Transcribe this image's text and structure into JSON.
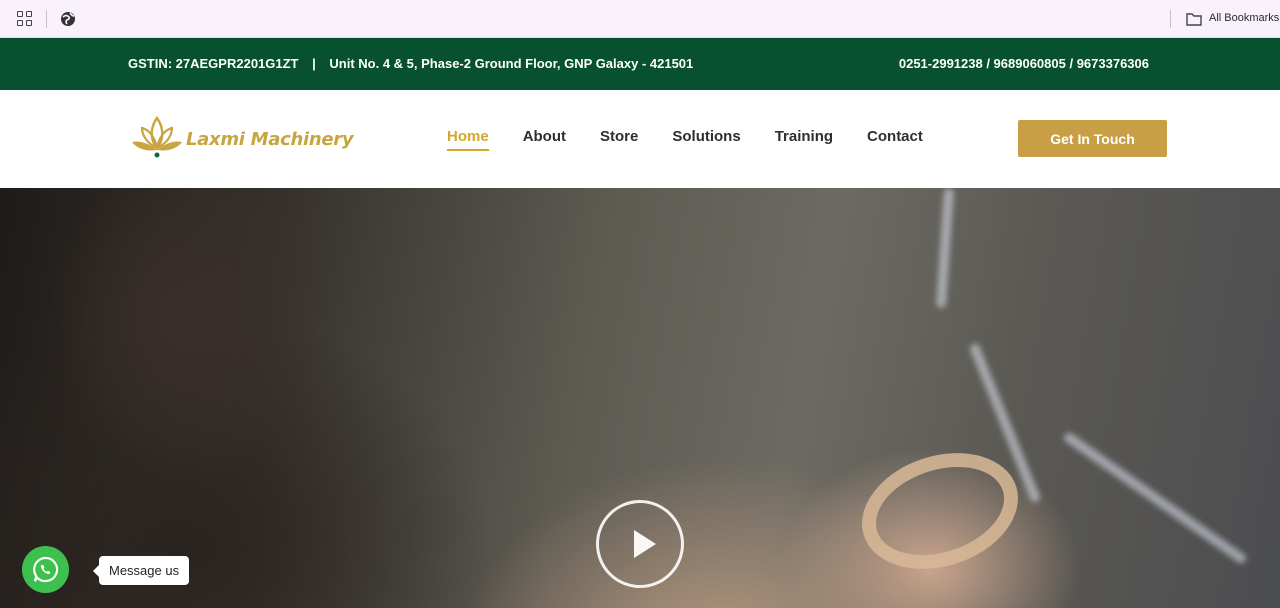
{
  "browser": {
    "bookmarks_label": "All Bookmarks"
  },
  "topbar": {
    "gstin": "GSTIN: 27AEGPR2201G1ZT",
    "divider": "|",
    "address": "Unit No. 4 & 5, Phase-2 Ground Floor, GNP Galaxy - 421501",
    "phones": "0251-2991238 / 9689060805 / 9673376306"
  },
  "header": {
    "logo_text": "Laxmi Machinery",
    "nav": [
      {
        "label": "Home",
        "active": true
      },
      {
        "label": "About"
      },
      {
        "label": "Store"
      },
      {
        "label": "Solutions"
      },
      {
        "label": "Training"
      },
      {
        "label": "Contact"
      }
    ],
    "cta_label": "Get In Touch"
  },
  "hero": {
    "play_icon": "play-icon"
  },
  "whatsapp": {
    "tooltip": "Message us",
    "icon": "whatsapp-icon"
  },
  "colors": {
    "topbar_bg": "#075030",
    "accent_gold": "#d6a72e",
    "cta_bg": "#c89f45",
    "whatsapp_green": "#3dc04e"
  }
}
